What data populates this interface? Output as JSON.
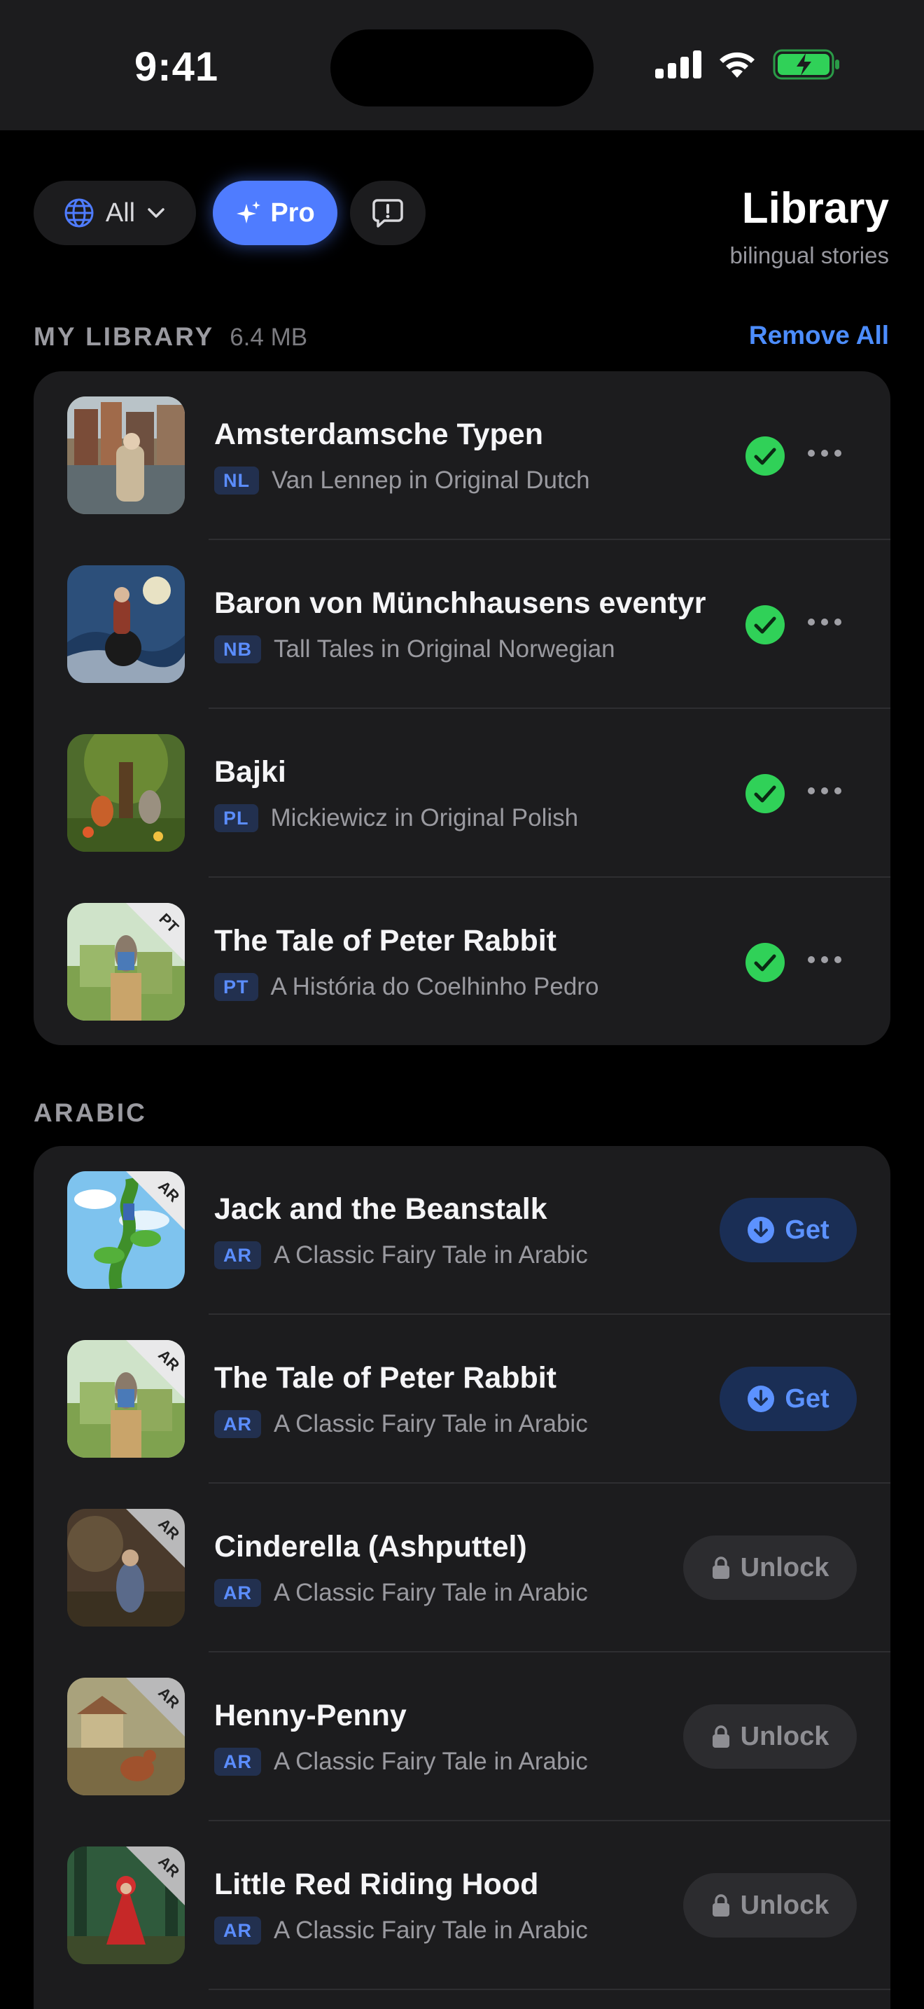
{
  "status_bar": {
    "time": "9:41"
  },
  "header": {
    "filter_label": "All",
    "pro_label": "Pro",
    "title": "Library",
    "subtitle": "bilingual stories"
  },
  "my_library": {
    "heading": "MY LIBRARY",
    "size": "6.4 MB",
    "remove_all": "Remove All",
    "items": [
      {
        "title": "Amsterdamsche Typen",
        "lang": "NL",
        "subtitle": "Van Lennep in Original Dutch",
        "status": "downloaded"
      },
      {
        "title": "Baron von Münchhausens eventyr",
        "lang": "NB",
        "subtitle": "Tall Tales in Original Norwegian",
        "status": "downloaded"
      },
      {
        "title": "Bajki",
        "lang": "PL",
        "subtitle": "Mickiewicz in Original Polish",
        "status": "downloaded"
      },
      {
        "title": "The Tale of Peter Rabbit",
        "lang": "PT",
        "subtitle": "A História do Coelhinho Pedro",
        "status": "downloaded",
        "corner": "PT"
      }
    ]
  },
  "arabic": {
    "heading": "ARABIC",
    "get_label": "Get",
    "unlock_label": "Unlock",
    "items": [
      {
        "title": "Jack and the Beanstalk",
        "lang": "AR",
        "subtitle": "A Classic Fairy Tale in Arabic",
        "action": "get",
        "corner": "AR"
      },
      {
        "title": "The Tale of Peter Rabbit",
        "lang": "AR",
        "subtitle": "A Classic Fairy Tale in Arabic",
        "action": "get",
        "corner": "AR"
      },
      {
        "title": "Cinderella (Ashputtel)",
        "lang": "AR",
        "subtitle": "A Classic Fairy Tale in Arabic",
        "action": "unlock",
        "corner": "AR"
      },
      {
        "title": "Henny-Penny",
        "lang": "AR",
        "subtitle": "A Classic Fairy Tale in Arabic",
        "action": "unlock",
        "corner": "AR"
      },
      {
        "title": "Little Red Riding Hood",
        "lang": "AR",
        "subtitle": "A Classic Fairy Tale in Arabic",
        "action": "unlock",
        "corner": "AR"
      }
    ]
  },
  "colors": {
    "accent": "#4f7cff",
    "check_green": "#30d158",
    "card_bg": "#1c1c1e",
    "lang_badge_text": "#5b8dff"
  }
}
